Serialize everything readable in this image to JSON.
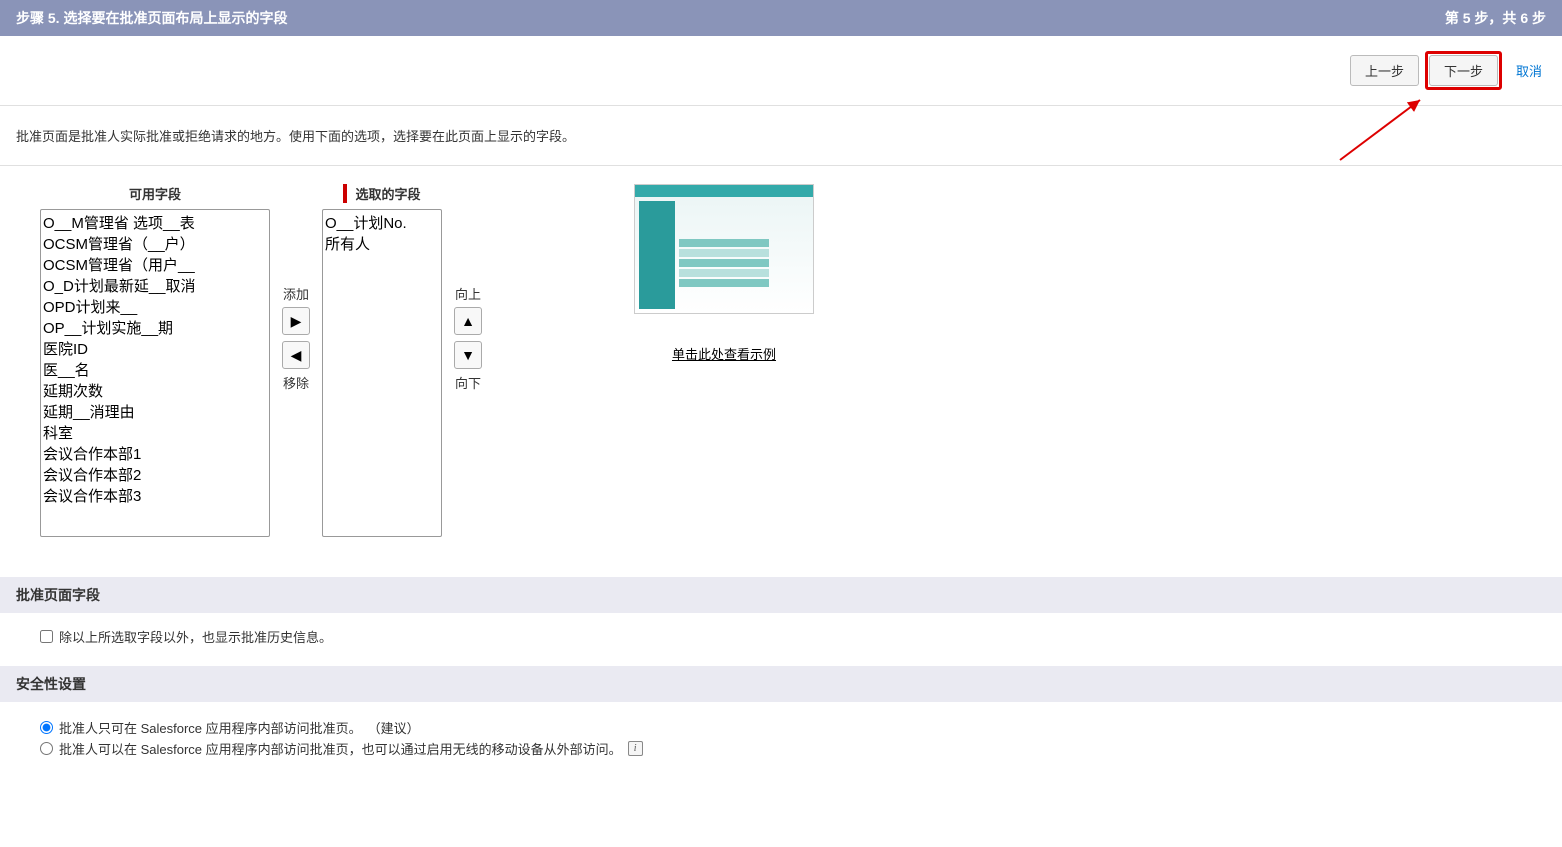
{
  "header": {
    "title": "步骤 5. 选择要在批准页面布局上显示的字段",
    "step_indicator": "第 5 步，共 6 步"
  },
  "nav": {
    "prev": "上一步",
    "next": "下一步",
    "cancel": "取消"
  },
  "description": "批准页面是批准人实际批准或拒绝请求的地方。使用下面的选项，选择要在此页面上显示的字段。",
  "picker": {
    "available_header": "可用字段",
    "selected_header": "选取的字段",
    "add_label": "添加",
    "remove_label": "移除",
    "up_label": "向上",
    "down_label": "向下",
    "available": [
      "O__M管理省 选项__表",
      "OCSM管理省（__户）",
      "OCSM管理省（用户__",
      "O_D计划最新延__取消",
      "OPD计划来__",
      "OP__计划实施__期",
      "医院ID",
      "医__名",
      "延期次数",
      "延期__消理由",
      "科室",
      "会议合作本部1",
      "会议合作本部2",
      "会议合作本部3"
    ],
    "selected": [
      "O__计划No.",
      "所有人"
    ]
  },
  "example": {
    "link_text": "单击此处查看示例"
  },
  "section_fields": {
    "title": "批准页面字段",
    "checkbox_label": "除以上所选取字段以外，也显示批准历史信息。"
  },
  "section_security": {
    "title": "安全性设置",
    "option1": "批准人只可在 Salesforce 应用程序内部访问批准页。",
    "option1_suffix": "（建议）",
    "option2": "批准人可以在 Salesforce 应用程序内部访问批准页，也可以通过启用无线的移动设备从外部访问。"
  }
}
